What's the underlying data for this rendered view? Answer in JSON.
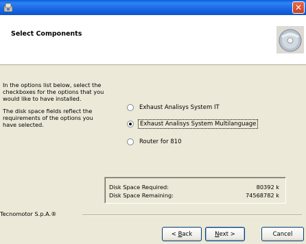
{
  "window": {
    "app_icon": "setup-icon",
    "close_glyph": "✕",
    "colors": {
      "titlebar": "#1C6AE6",
      "close": "#D14E2E",
      "face": "#ECE9D8"
    }
  },
  "header": {
    "title": "Select Components",
    "icon": "cd-disc-icon"
  },
  "instructions": {
    "paragraph1": "In the options list below, select the checkboxes for the options that you would like to have installed.",
    "paragraph2": "The disk space fields reflect the requirements of the options you have selected."
  },
  "options": [
    {
      "label": "Exhaust Analisys System IT",
      "selected": false
    },
    {
      "label": "Exhaust Analisys System Multilanguage",
      "selected": true
    },
    {
      "label": "Router for 810",
      "selected": false
    }
  ],
  "disk": {
    "required_label": "Disk Space Required:",
    "required_value": "80392 k",
    "remaining_label": "Disk Space Remaining:",
    "remaining_value": "74568782 k"
  },
  "footer": {
    "brand": "Tecnomotor S.p.A.®"
  },
  "buttons": {
    "back_mnemonic": "B",
    "back_rest": "ack",
    "back_prefix": "< ",
    "next_mnemonic": "N",
    "next_rest": "ext",
    "next_suffix": " >",
    "cancel": "Cancel"
  }
}
